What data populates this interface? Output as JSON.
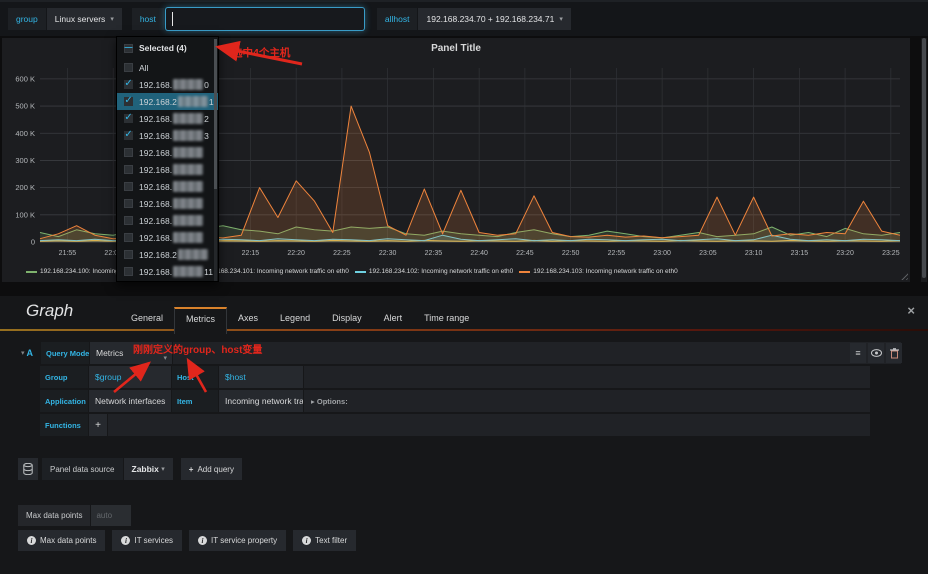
{
  "colors": {
    "accent_cyan": "#33b5e5",
    "annotation_red": "#e0261c",
    "dropdown_highlight": "#20627b",
    "tab_active_border": "#d9822b"
  },
  "icons": {
    "caret_down": "▾",
    "check": "✓",
    "indeterminate_dash": "—",
    "plus": "+",
    "close": "×",
    "menu": "≡",
    "options_arrow": "▸"
  },
  "topbar": {
    "group_label": "group",
    "group_value": "Linux servers",
    "host_label": "host",
    "host_value": "",
    "allhost_label": "allhost",
    "allhost_value": "192.168.234.70 + 192.168.234.71"
  },
  "host_dropdown": {
    "header": "Selected (4)",
    "items": [
      {
        "label": "All",
        "prefix": "",
        "suffix": "",
        "checked": false,
        "highlighted": false,
        "redacted": false
      },
      {
        "label": "",
        "prefix": "192.168.",
        "suffix": "0",
        "checked": true,
        "highlighted": false,
        "redacted": true
      },
      {
        "label": "",
        "prefix": "192.168.2",
        "suffix": "1",
        "checked": true,
        "highlighted": true,
        "redacted": true
      },
      {
        "label": "",
        "prefix": "192.168.",
        "suffix": "2",
        "checked": true,
        "highlighted": false,
        "redacted": true
      },
      {
        "label": "",
        "prefix": "192.168.",
        "suffix": "3",
        "checked": true,
        "highlighted": false,
        "redacted": true
      },
      {
        "label": "",
        "prefix": "192.168.",
        "suffix": "",
        "checked": false,
        "highlighted": false,
        "redacted": true
      },
      {
        "label": "",
        "prefix": "192.168.",
        "suffix": "",
        "checked": false,
        "highlighted": false,
        "redacted": true
      },
      {
        "label": "",
        "prefix": "192.168.",
        "suffix": "",
        "checked": false,
        "highlighted": false,
        "redacted": true
      },
      {
        "label": "",
        "prefix": "192.168.",
        "suffix": "",
        "checked": false,
        "highlighted": false,
        "redacted": true
      },
      {
        "label": "",
        "prefix": "192.168.",
        "suffix": "",
        "checked": false,
        "highlighted": false,
        "redacted": true
      },
      {
        "label": "",
        "prefix": "192.168.",
        "suffix": "",
        "checked": false,
        "highlighted": false,
        "redacted": true
      },
      {
        "label": "",
        "prefix": "192.168.2",
        "suffix": "",
        "checked": false,
        "highlighted": false,
        "redacted": true
      },
      {
        "label": "",
        "prefix": "192.168.",
        "suffix": "11",
        "checked": false,
        "highlighted": false,
        "redacted": true
      }
    ]
  },
  "annotations": {
    "selected_note": "选中4个主机",
    "variables_note": "刚刚定义的group、host变量"
  },
  "panel": {
    "title": "Panel Title"
  },
  "chart_data": {
    "type": "area",
    "title": "Panel Title",
    "x_start_label": "21:52",
    "x_step_min": 2,
    "x_span_min": 94,
    "x_tick_first_min": 3,
    "x_tick_step_min": 5,
    "x_tick_labels": [
      "21:55",
      "22:00",
      "22:05",
      "22:10",
      "22:15",
      "22:20",
      "22:25",
      "22:30",
      "22:35",
      "22:40",
      "22:45",
      "22:50",
      "22:55",
      "23:00",
      "23:05",
      "23:10",
      "23:15",
      "23:20",
      "23:25"
    ],
    "y_tick_labels": [
      "0",
      "100 K",
      "200 K",
      "300 K",
      "400 K",
      "500 K",
      "600 K"
    ],
    "y_tick_step_k": 100,
    "ylim_k": [
      0,
      640
    ],
    "grid": true,
    "legend_position": "bottom",
    "series": [
      {
        "name": "192.168.234.100: Incoming network traffic on eth0",
        "color": "#7EB26D",
        "values_k": [
          35,
          20,
          45,
          30,
          25,
          40,
          30,
          25,
          35,
          50,
          60,
          45,
          40,
          30,
          55,
          45,
          40,
          55,
          50,
          55,
          30,
          25,
          40,
          30,
          25,
          20,
          35,
          45,
          30,
          20,
          25,
          40,
          30,
          20,
          15,
          25,
          35,
          20,
          25,
          30,
          55,
          25,
          35,
          20,
          50,
          30,
          25,
          35
        ]
      },
      {
        "name": "192.168.234.101: Incoming network traffic on eth0",
        "color": "#EAB839",
        "values_k": [
          3,
          5,
          3,
          6,
          3,
          5,
          3,
          6,
          4,
          3,
          5,
          4,
          3,
          5,
          4,
          3,
          6,
          4,
          3,
          5,
          3,
          6,
          4,
          3,
          5,
          4,
          3,
          6,
          3,
          5,
          4,
          3,
          5,
          4,
          3,
          6,
          4,
          3,
          5,
          4,
          3,
          6,
          4,
          3,
          5,
          4,
          3,
          5
        ]
      },
      {
        "name": "192.168.234.102: Incoming network traffic on eth0",
        "color": "#6ED0E0",
        "values_k": [
          5,
          8,
          5,
          10,
          5,
          8,
          5,
          10,
          8,
          5,
          10,
          8,
          5,
          12,
          8,
          5,
          10,
          8,
          5,
          12,
          8,
          5,
          25,
          10,
          5,
          8,
          12,
          5,
          8,
          5,
          10,
          8,
          5,
          8,
          10,
          5,
          8,
          12,
          5,
          8,
          25,
          10,
          5,
          8,
          5,
          10,
          8,
          5
        ]
      },
      {
        "name": "192.168.234.103: Incoming network traffic on eth0",
        "color": "#EF843C",
        "values_k": [
          12,
          30,
          60,
          25,
          12,
          15,
          10,
          18,
          12,
          20,
          15,
          25,
          200,
          90,
          225,
          150,
          35,
          500,
          330,
          60,
          25,
          195,
          30,
          190,
          35,
          25,
          30,
          170,
          35,
          20,
          18,
          25,
          18,
          22,
          16,
          20,
          25,
          165,
          25,
          165,
          22,
          30,
          25,
          35,
          30,
          150,
          40,
          25
        ]
      }
    ]
  },
  "editor": {
    "title": "Graph",
    "tabs": [
      {
        "label": "General",
        "active": false
      },
      {
        "label": "Metrics",
        "active": true
      },
      {
        "label": "Axes",
        "active": false
      },
      {
        "label": "Legend",
        "active": false
      },
      {
        "label": "Display",
        "active": false
      },
      {
        "label": "Alert",
        "active": false
      },
      {
        "label": "Time range",
        "active": false
      }
    ],
    "query": {
      "ref": "A",
      "query_mode_label": "Query Mode",
      "query_mode_value": "Metrics",
      "group_label": "Group",
      "group_value": "$group",
      "host_label": "Host",
      "host_value": "$host",
      "application_label": "Application",
      "application_value": "Network interfaces",
      "item_label": "Item",
      "item_value": "Incoming network traffic",
      "options_label": "Options:",
      "functions_label": "Functions"
    },
    "datasource": {
      "label": "Panel data source",
      "value": "Zabbix",
      "add_query_label": "Add query"
    },
    "max_data_points": {
      "label": "Max data points",
      "placeholder": "auto"
    },
    "bottom_buttons": [
      "Max data points",
      "IT services",
      "IT service property",
      "Text filter"
    ]
  }
}
